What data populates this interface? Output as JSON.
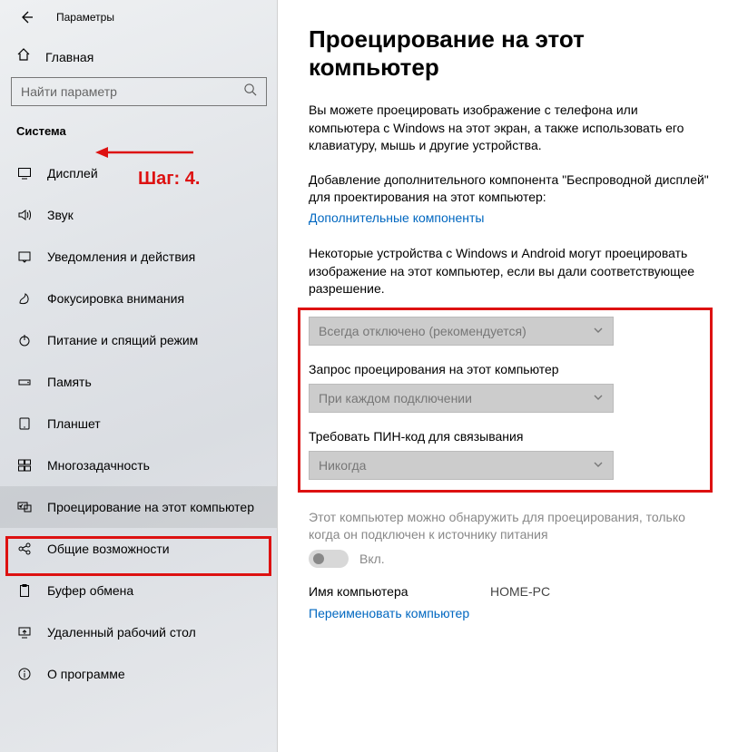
{
  "header": {
    "app_title": "Параметры"
  },
  "sidebar": {
    "home_label": "Главная",
    "search_placeholder": "Найти параметр",
    "section_label": "Система",
    "items": [
      {
        "icon": "display-icon",
        "label": "Дисплей"
      },
      {
        "icon": "sound-icon",
        "label": "Звук"
      },
      {
        "icon": "notify-icon",
        "label": "Уведомления и действия"
      },
      {
        "icon": "focus-icon",
        "label": "Фокусировка внимания"
      },
      {
        "icon": "power-icon",
        "label": "Питание и спящий режим"
      },
      {
        "icon": "storage-icon",
        "label": "Память"
      },
      {
        "icon": "tablet-icon",
        "label": "Планшет"
      },
      {
        "icon": "multitask-icon",
        "label": "Многозадачность"
      },
      {
        "icon": "project-icon",
        "label": "Проецирование на этот компьютер"
      },
      {
        "icon": "shared-icon",
        "label": "Общие возможности"
      },
      {
        "icon": "clipboard-icon",
        "label": "Буфер обмена"
      },
      {
        "icon": "remote-icon",
        "label": "Удаленный рабочий стол"
      },
      {
        "icon": "about-icon",
        "label": "О программе"
      }
    ],
    "active_index": 8
  },
  "annotation": {
    "step_label": "Шаг: 4."
  },
  "main": {
    "title": "Проецирование на этот компьютер",
    "intro": "Вы можете проецировать изображение с телефона или компьютера с Windows на этот экран, а также использовать его клавиатуру, мышь и другие устройства.",
    "addon_note": "Добавление дополнительного компонента \"Беспроводной дисплей\" для проектирования на этот компьютер:",
    "addon_link": "Дополнительные компоненты",
    "perm_note": "Некоторые устройства с Windows и Android могут проецировать изображение на этот компьютер, если вы дали соответствующее разрешение.",
    "dropdowns": {
      "d1": {
        "value": "Всегда отключено (рекомендуется)"
      },
      "d2": {
        "label": "Запрос проецирования на этот компьютер",
        "value": "При каждом подключении"
      },
      "d3": {
        "label": "Требовать ПИН-код для связывания",
        "value": "Никогда"
      }
    },
    "discover_note": "Этот компьютер можно обнаружить для проецирования, только когда он подключен к источнику питания",
    "toggle_label": "Вкл.",
    "pc_name_label": "Имя компьютера",
    "pc_name_value": "HOME-PC",
    "rename_link": "Переименовать компьютер"
  }
}
